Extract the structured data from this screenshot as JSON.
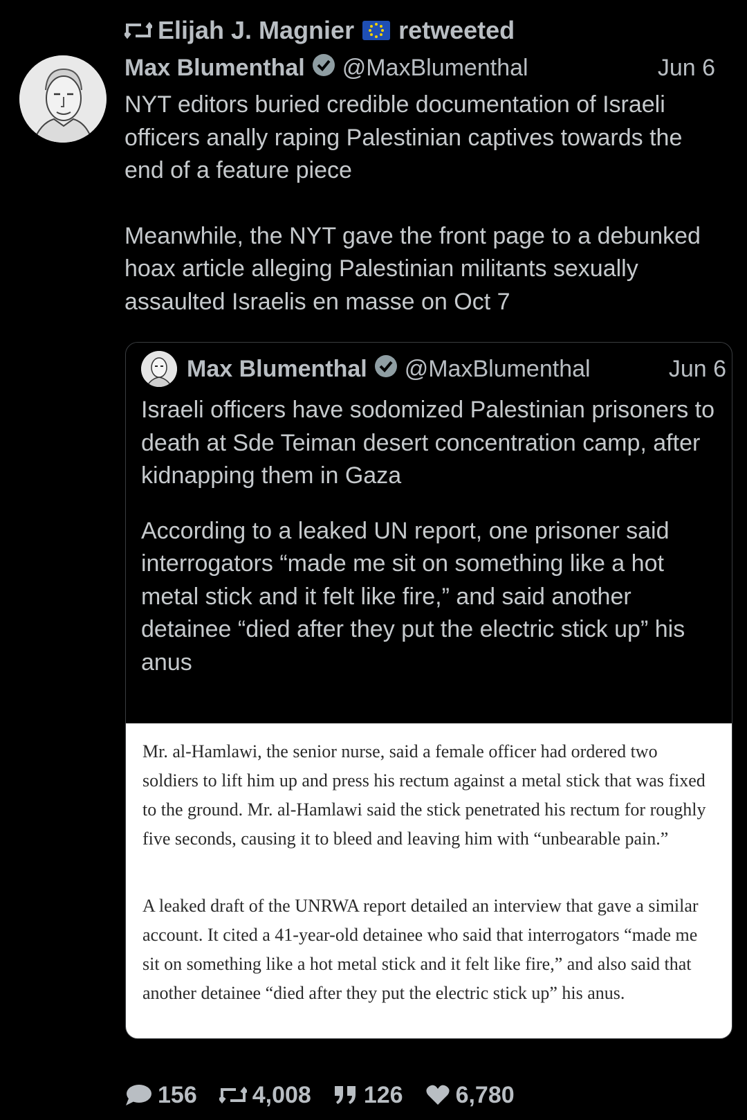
{
  "retweet_banner": {
    "name": "Elijah J. Magnier",
    "action": "retweeted",
    "icons": [
      "retweet-icon",
      "eu-flag-icon"
    ]
  },
  "tweet": {
    "author_name": "Max Blumenthal",
    "handle": "@MaxBlumenthal",
    "date": "Jun 6",
    "paragraphs": [
      "NYT editors buried credible documentation of Israeli officers anally raping Palestinian captives towards the end of a feature piece",
      "Meanwhile, the NYT gave the front page to a debunked hoax article alleging Palestinian militants sexually assaulted Israelis en masse on Oct 7"
    ]
  },
  "quote": {
    "author_name": "Max Blumenthal",
    "handle": "@MaxBlumenthal",
    "date": "Jun 6",
    "paragraphs": [
      "Israeli officers have sodomized Palestinian prisoners to death at Sde Teiman desert concentration camp, after kidnapping them in Gaza",
      "According to a leaked UN report, one prisoner said interrogators “made me sit on something like a hot metal stick and it felt like fire,” and said another detainee “died after they put the electric stick up” his anus"
    ],
    "article_paragraphs": [
      "Mr. al-Hamlawi, the senior nurse, said a female officer had ordered two soldiers to lift him up and press his rectum against a metal stick that was fixed to the ground. Mr. al-Hamlawi said the stick penetrated his rectum for roughly five seconds, causing it to bleed and leaving him with “unbearable pain.”",
      "A leaked draft of the UNRWA report detailed an interview that gave a similar account. It cited a 41-year-old detainee who said that interrogators “made me sit on something like a hot metal stick and it felt like fire,” and also said that another detainee “died after they put the electric stick up” his anus."
    ]
  },
  "actions": {
    "replies": "156",
    "retweets": "4,008",
    "quotes": "126",
    "likes": "6,780"
  },
  "colors": {
    "background": "#000000",
    "text": "#c6cacd",
    "muted": "#b9bec3",
    "verified_badge": "#8f9ea3",
    "quote_border": "#3a3d40"
  }
}
